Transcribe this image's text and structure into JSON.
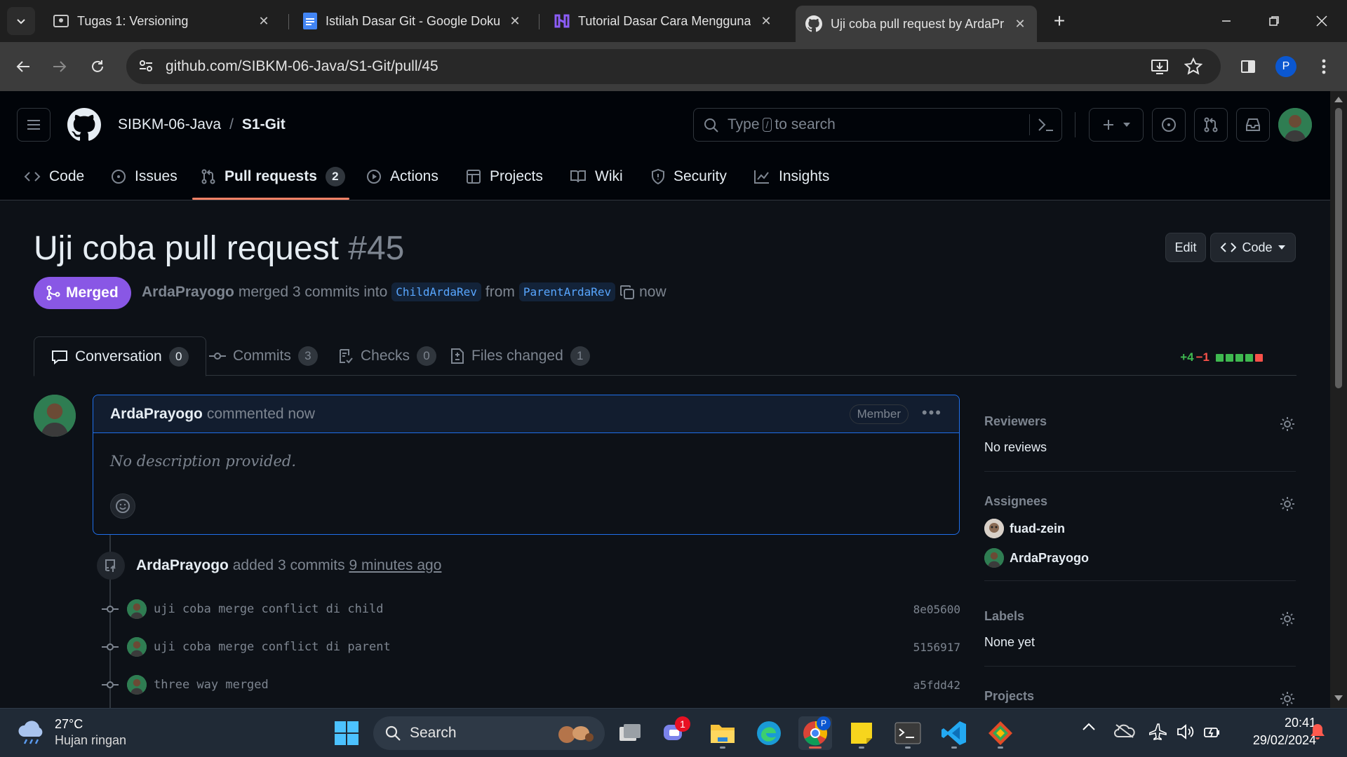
{
  "browser": {
    "tabs": [
      {
        "title": "Tugas 1: Versioning",
        "icon": "classroom-icon"
      },
      {
        "title": "Istilah Dasar Git - Google Dokumen",
        "icon": "google-docs-icon"
      },
      {
        "title": "Tutorial Dasar Cara Menggunakan",
        "icon": "site-icon"
      },
      {
        "title": "Uji coba pull request by ArdaPrayogo",
        "icon": "github-icon"
      }
    ],
    "url": "github.com/SIBKM-06-Java/S1-Git/pull/45",
    "profile_initial": "P"
  },
  "github": {
    "owner": "SIBKM-06-Java",
    "separator": "/",
    "repo": "S1-Git",
    "search": {
      "prefix": "Type",
      "key": "/",
      "suffix": "to search"
    },
    "nav": [
      {
        "label": "Code",
        "icon": "code-icon"
      },
      {
        "label": "Issues",
        "icon": "issue-icon"
      },
      {
        "label": "Pull requests",
        "icon": "pull-request-icon",
        "count": "2"
      },
      {
        "label": "Actions",
        "icon": "play-icon"
      },
      {
        "label": "Projects",
        "icon": "table-icon"
      },
      {
        "label": "Wiki",
        "icon": "book-icon"
      },
      {
        "label": "Security",
        "icon": "shield-icon"
      },
      {
        "label": "Insights",
        "icon": "graph-icon"
      }
    ]
  },
  "pr": {
    "title": "Uji coba pull request",
    "number": "#45",
    "edit_label": "Edit",
    "code_label": "Code",
    "state": "Merged",
    "author": "ArdaPrayogo",
    "meta_merged": "merged 3 commits into",
    "base_branch": "ChildArdaRev",
    "meta_from": "from",
    "head_branch": "ParentArdaRev",
    "merged_time": "now",
    "tabs": [
      {
        "label": "Conversation",
        "count": "0",
        "icon": "comment-icon"
      },
      {
        "label": "Commits",
        "count": "3",
        "icon": "commit-icon"
      },
      {
        "label": "Checks",
        "count": "0",
        "icon": "checklist-icon"
      },
      {
        "label": "Files changed",
        "count": "1",
        "icon": "file-diff-icon"
      }
    ],
    "additions": "+4",
    "deletions": "−1",
    "diff_colors": {
      "add": "#3fb950",
      "del": "#f85149"
    },
    "comment": {
      "author": "ArdaPrayogo",
      "action": "commented now",
      "badge": "Member",
      "body": "No description provided."
    },
    "timeline": {
      "actor": "ArdaPrayogo",
      "action": "added 3 commits",
      "time": "9 minutes ago",
      "commits": [
        {
          "message": "uji coba merge conflict di child",
          "sha": "8e05600"
        },
        {
          "message": "uji coba merge conflict di parent",
          "sha": "5156917"
        },
        {
          "message": "three way merged",
          "sha": "a5fdd42"
        }
      ]
    }
  },
  "sidebar": {
    "reviewers": {
      "title": "Reviewers",
      "value": "No reviews"
    },
    "assignees": {
      "title": "Assignees",
      "people": [
        "fuad-zein",
        "ArdaPrayogo"
      ]
    },
    "labels": {
      "title": "Labels",
      "value": "None yet"
    },
    "projects": {
      "title": "Projects"
    }
  },
  "taskbar": {
    "weather_temp": "27°C",
    "weather_desc": "Hujan ringan",
    "search_label": "Search",
    "chat_badge": "1",
    "time": "20:41",
    "date": "29/02/2024"
  }
}
